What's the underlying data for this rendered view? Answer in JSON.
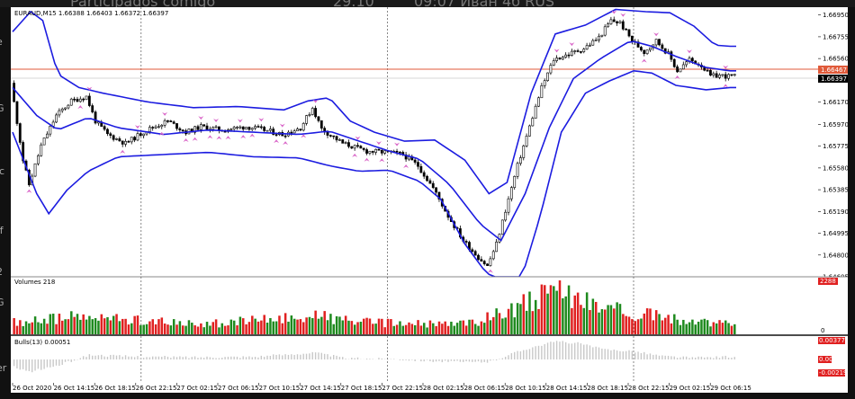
{
  "window": {
    "top_fragments": [
      "Participados comigo",
      "29.10",
      "09:07 Иван 4б RUS"
    ],
    "left_fragments": [
      "e",
      "G",
      "ic",
      "ff",
      "2",
      "G",
      "er"
    ]
  },
  "chart_data": [
    {
      "type": "candlestick",
      "title": "EURAUD,M15 1.66388 1.66403 1.66372 1.66397",
      "ylim": [
        1.64605,
        1.6702
      ],
      "y_ticks": [
        "1.66950",
        "1.66755",
        "1.66560",
        "1.66365",
        "1.66170",
        "1.65970",
        "1.65775",
        "1.65580",
        "1.65385",
        "1.65190",
        "1.64995",
        "1.64800",
        "1.64605"
      ],
      "current_price": "1.66397",
      "horizontal_line_price": "1.66467",
      "x_ticks": [
        "26 Oct 2020",
        "26 Oct 14:15",
        "26 Oct 18:15",
        "26 Oct 22:15",
        "27 Oct 02:15",
        "27 Oct 06:15",
        "27 Oct 10:15",
        "27 Oct 14:15",
        "27 Oct 18:15",
        "27 Oct 22:15",
        "28 Oct 02:15",
        "28 Oct 06:15",
        "28 Oct 10:15",
        "28 Oct 14:15",
        "28 Oct 18:15",
        "28 Oct 22:15",
        "29 Oct 02:15",
        "29 Oct 06:15"
      ],
      "vertical_separators": [
        "26 Oct 22:15",
        "27 Oct 22:15",
        "28 Oct 22:15"
      ],
      "price_path": [
        [
          0,
          1.6634
        ],
        [
          4,
          1.6565
        ],
        [
          6,
          1.6543
        ],
        [
          10,
          1.6578
        ],
        [
          15,
          1.6605
        ],
        [
          20,
          1.6618
        ],
        [
          25,
          1.6622
        ],
        [
          28,
          1.66
        ],
        [
          32,
          1.6588
        ],
        [
          38,
          1.658
        ],
        [
          45,
          1.6592
        ],
        [
          52,
          1.66
        ],
        [
          58,
          1.659
        ],
        [
          63,
          1.6595
        ],
        [
          70,
          1.6592
        ],
        [
          78,
          1.6595
        ],
        [
          84,
          1.6592
        ],
        [
          90,
          1.6588
        ],
        [
          96,
          1.6594
        ],
        [
          100,
          1.6612
        ],
        [
          103,
          1.6593
        ],
        [
          110,
          1.658
        ],
        [
          118,
          1.6573
        ],
        [
          125,
          1.6572
        ],
        [
          130,
          1.657
        ],
        [
          135,
          1.656
        ],
        [
          140,
          1.654
        ],
        [
          145,
          1.6515
        ],
        [
          150,
          1.6493
        ],
        [
          155,
          1.6478
        ],
        [
          158,
          1.647
        ],
        [
          161,
          1.649
        ],
        [
          164,
          1.652
        ],
        [
          168,
          1.656
        ],
        [
          172,
          1.6595
        ],
        [
          176,
          1.663
        ],
        [
          180,
          1.6655
        ],
        [
          185,
          1.666
        ],
        [
          190,
          1.6665
        ],
        [
          195,
          1.6675
        ],
        [
          199,
          1.669
        ],
        [
          202,
          1.6688
        ],
        [
          206,
          1.6672
        ],
        [
          210,
          1.6662
        ],
        [
          214,
          1.6672
        ],
        [
          218,
          1.666
        ],
        [
          221,
          1.6645
        ],
        [
          225,
          1.6655
        ],
        [
          229,
          1.665
        ],
        [
          232,
          1.664
        ],
        [
          235,
          1.6641
        ],
        [
          238,
          1.664
        ]
      ],
      "bb_mid_path": [
        [
          0,
          1.663
        ],
        [
          8,
          1.6605
        ],
        [
          15,
          1.6592
        ],
        [
          25,
          1.6603
        ],
        [
          35,
          1.6594
        ],
        [
          50,
          1.6588
        ],
        [
          65,
          1.6592
        ],
        [
          80,
          1.659
        ],
        [
          95,
          1.6588
        ],
        [
          105,
          1.6591
        ],
        [
          115,
          1.6582
        ],
        [
          125,
          1.6573
        ],
        [
          135,
          1.6566
        ],
        [
          145,
          1.6543
        ],
        [
          155,
          1.6508
        ],
        [
          162,
          1.6493
        ],
        [
          170,
          1.6535
        ],
        [
          178,
          1.6594
        ],
        [
          186,
          1.6638
        ],
        [
          195,
          1.6656
        ],
        [
          205,
          1.6672
        ],
        [
          212,
          1.6667
        ],
        [
          220,
          1.6658
        ],
        [
          230,
          1.6648
        ],
        [
          238,
          1.6645
        ]
      ],
      "bb_upper_path": [
        [
          0,
          1.668
        ],
        [
          6,
          1.6698
        ],
        [
          10,
          1.669
        ],
        [
          15,
          1.6642
        ],
        [
          22,
          1.663
        ],
        [
          30,
          1.6625
        ],
        [
          45,
          1.6617
        ],
        [
          60,
          1.6612
        ],
        [
          75,
          1.6613
        ],
        [
          90,
          1.661
        ],
        [
          98,
          1.6618
        ],
        [
          105,
          1.6621
        ],
        [
          112,
          1.66
        ],
        [
          120,
          1.659
        ],
        [
          130,
          1.6582
        ],
        [
          140,
          1.6583
        ],
        [
          150,
          1.6565
        ],
        [
          158,
          1.6535
        ],
        [
          164,
          1.6545
        ],
        [
          172,
          1.6625
        ],
        [
          180,
          1.6678
        ],
        [
          190,
          1.6686
        ],
        [
          200,
          1.67
        ],
        [
          210,
          1.6698
        ],
        [
          218,
          1.6697
        ],
        [
          226,
          1.6685
        ],
        [
          233,
          1.6668
        ],
        [
          238,
          1.6667
        ]
      ],
      "bb_lower_path": [
        [
          0,
          1.659
        ],
        [
          8,
          1.6535
        ],
        [
          12,
          1.6517
        ],
        [
          18,
          1.6538
        ],
        [
          25,
          1.6555
        ],
        [
          35,
          1.6568
        ],
        [
          50,
          1.657
        ],
        [
          65,
          1.6572
        ],
        [
          80,
          1.6568
        ],
        [
          95,
          1.6567
        ],
        [
          105,
          1.656
        ],
        [
          115,
          1.6555
        ],
        [
          125,
          1.6556
        ],
        [
          135,
          1.6546
        ],
        [
          142,
          1.653
        ],
        [
          150,
          1.649
        ],
        [
          156,
          1.6468
        ],
        [
          162,
          1.6452
        ],
        [
          168,
          1.6452
        ],
        [
          175,
          1.6515
        ],
        [
          182,
          1.659
        ],
        [
          190,
          1.6625
        ],
        [
          198,
          1.6636
        ],
        [
          206,
          1.6645
        ],
        [
          212,
          1.6643
        ],
        [
          220,
          1.6632
        ],
        [
          230,
          1.6628
        ],
        [
          238,
          1.663
        ]
      ],
      "fractal_arrows": "pink arrows above highs and below lows (decorative marks)"
    },
    {
      "type": "bar",
      "title": "Volumes 218",
      "top_value": "2288",
      "bottom_value": "0",
      "colors": {
        "up": "#1e8a1e",
        "down": "#e02020"
      },
      "volume_path": [
        [
          0,
          0.25
        ],
        [
          20,
          0.35
        ],
        [
          40,
          0.3
        ],
        [
          60,
          0.2
        ],
        [
          80,
          0.28
        ],
        [
          100,
          0.38
        ],
        [
          115,
          0.25
        ],
        [
          130,
          0.22
        ],
        [
          145,
          0.2
        ],
        [
          155,
          0.28
        ],
        [
          165,
          0.55
        ],
        [
          172,
          0.7
        ],
        [
          180,
          0.85
        ],
        [
          188,
          0.75
        ],
        [
          195,
          0.55
        ],
        [
          205,
          0.45
        ],
        [
          215,
          0.35
        ],
        [
          225,
          0.25
        ],
        [
          238,
          0.2
        ]
      ]
    },
    {
      "type": "histogram",
      "title": "Bulls(13) 0.00051",
      "top_value": "0.00377",
      "mid_value": "0.00",
      "bottom_value": "-0.00219",
      "bulls_path": [
        [
          0,
          -0.0012
        ],
        [
          5,
          -0.0022
        ],
        [
          15,
          -0.001
        ],
        [
          25,
          0.0008
        ],
        [
          40,
          0.0005
        ],
        [
          60,
          0.0004
        ],
        [
          80,
          0.0005
        ],
        [
          100,
          0.0012
        ],
        [
          110,
          0.0002
        ],
        [
          125,
          0.0001
        ],
        [
          140,
          -0.0003
        ],
        [
          150,
          -0.0005
        ],
        [
          158,
          -0.0004
        ],
        [
          165,
          0.001
        ],
        [
          172,
          0.0022
        ],
        [
          180,
          0.0032
        ],
        [
          188,
          0.0028
        ],
        [
          195,
          0.0018
        ],
        [
          205,
          0.0015
        ],
        [
          215,
          0.0006
        ],
        [
          225,
          0.0003
        ],
        [
          238,
          0.0005
        ]
      ]
    }
  ]
}
